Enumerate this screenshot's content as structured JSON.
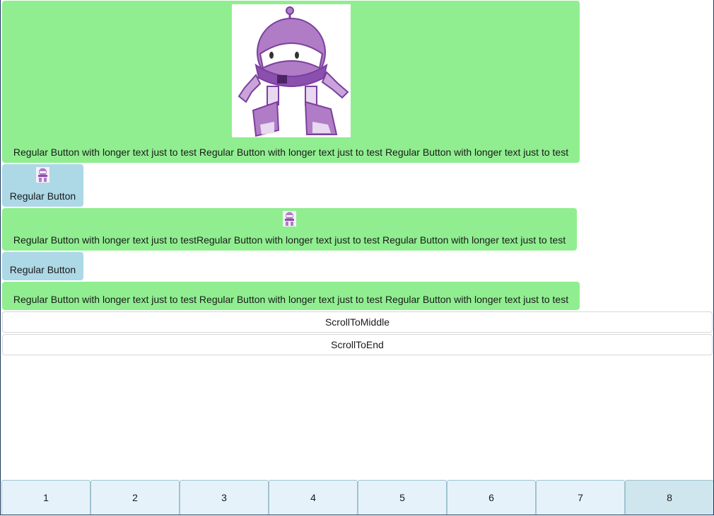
{
  "buttons": [
    {
      "label": "Regular Button with longer text just to test Regular Button with longer text just to test Regular Button with longer text just to test",
      "color": "#90ee90",
      "image": "robot-mascot"
    },
    {
      "label": "Regular Button",
      "color": "#add8e6",
      "image": "robot-mascot-small"
    },
    {
      "label": "Regular Button with longer text just to testRegular Button with longer text just to test Regular Button with longer text just to test",
      "color": "#90ee90",
      "image": "robot-mascot-small"
    },
    {
      "label": "Regular Button",
      "color": "#add8e6"
    },
    {
      "label": "Regular Button with longer text just to test Regular Button with longer text just to test Regular Button with longer text just to test",
      "color": "#90ee90"
    }
  ],
  "actions": {
    "scroll_to_middle": "ScrollToMiddle",
    "scroll_to_end": "ScrollToEnd"
  },
  "tabs": [
    "1",
    "2",
    "3",
    "4",
    "5",
    "6",
    "7",
    "8"
  ],
  "selected_tab": "8"
}
